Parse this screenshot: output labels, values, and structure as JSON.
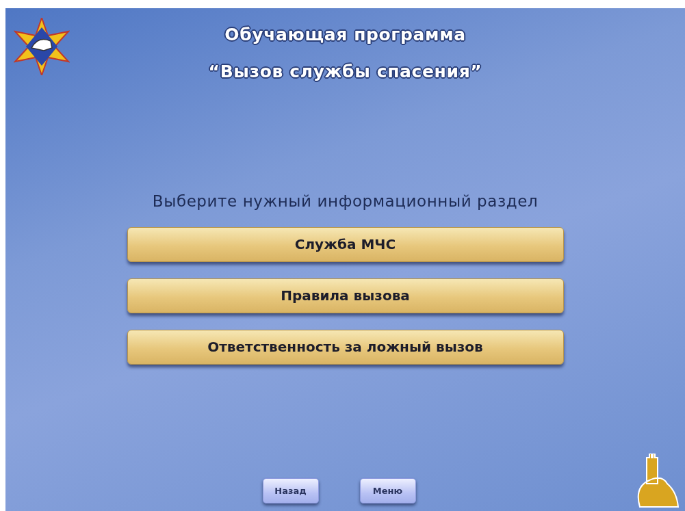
{
  "title": {
    "line_1": "Обучающая программа",
    "line_2": "“Вызов службы спасения”"
  },
  "prompt": "Выберите нужный информационный раздел",
  "sections": [
    {
      "label": "Служба МЧС"
    },
    {
      "label": "Правила вызова"
    },
    {
      "label": "Ответственность за ложный вызов"
    }
  ],
  "nav_buttons": [
    {
      "label": "Назад"
    },
    {
      "label": "Меню"
    }
  ]
}
